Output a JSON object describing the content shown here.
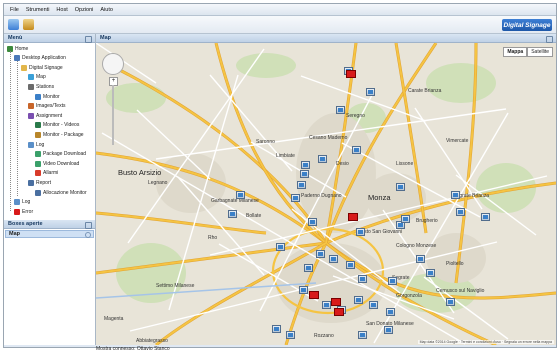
{
  "menubar": [
    "File",
    "Strumenti",
    "Host",
    "Opzioni",
    "Aiuto"
  ],
  "toolbar": {
    "logo": "Digital Signage"
  },
  "sidebar": {
    "title": "Menù",
    "tree": [
      {
        "label": "Home",
        "depth": 0,
        "icon": "home-icon"
      },
      {
        "label": "Desktop Application",
        "depth": 1,
        "icon": "app-icon"
      },
      {
        "label": "Digital Signage",
        "depth": 2,
        "icon": "folder-icon"
      },
      {
        "label": "Map",
        "depth": 3,
        "icon": "map-icon"
      },
      {
        "label": "Stations",
        "depth": 3,
        "icon": "station-icon"
      },
      {
        "label": "Monitor",
        "depth": 4,
        "icon": "monitor-icon"
      },
      {
        "label": "Images/Texts",
        "depth": 3,
        "icon": "image-icon"
      },
      {
        "label": "Assignment",
        "depth": 3,
        "icon": "assign-icon"
      },
      {
        "label": "Monitor - Videos",
        "depth": 4,
        "icon": "video-icon"
      },
      {
        "label": "Monitor - Package",
        "depth": 4,
        "icon": "package-icon"
      },
      {
        "label": "Log",
        "depth": 3,
        "icon": "log-icon"
      },
      {
        "label": "Package Download",
        "depth": 4,
        "icon": "download-icon"
      },
      {
        "label": "Video Download",
        "depth": 4,
        "icon": "download-icon"
      },
      {
        "label": "Allarmi",
        "depth": 4,
        "icon": "alarm-icon"
      },
      {
        "label": "Report",
        "depth": 3,
        "icon": "report-icon"
      },
      {
        "label": "Allocazione Monitor",
        "depth": 4,
        "icon": "report-icon"
      },
      {
        "label": "Log",
        "depth": 1,
        "icon": "log-icon"
      },
      {
        "label": "Error",
        "depth": 1,
        "icon": "error-icon"
      }
    ],
    "open_title": "Boxes aperte",
    "open_items": [
      "Map"
    ]
  },
  "main": {
    "title": "Map",
    "maptypes": [
      "Mappa",
      "Satellite"
    ],
    "copyright": "Map data ©2014 Google  ·  Termini e condizioni d'uso  ·  Segnala un errore nella mappa",
    "towns": [
      {
        "name": "Busto Arsizio",
        "big": true
      },
      {
        "name": "Legnano",
        "big": false
      },
      {
        "name": "Monza",
        "big": true
      },
      {
        "name": "Rho",
        "big": false
      },
      {
        "name": "Saronno",
        "big": false
      },
      {
        "name": "Cesano Maderno",
        "big": false
      },
      {
        "name": "Seregno",
        "big": false
      },
      {
        "name": "Paderno Dugnano",
        "big": false
      },
      {
        "name": "Sesto San Giovanni",
        "big": false
      },
      {
        "name": "Cologno Monzese",
        "big": false
      },
      {
        "name": "Segrate",
        "big": false
      },
      {
        "name": "Pioltello",
        "big": false
      },
      {
        "name": "Rozzano",
        "big": false
      },
      {
        "name": "Magenta",
        "big": false
      },
      {
        "name": "Vimercate",
        "big": false
      },
      {
        "name": "Gorgonzola",
        "big": false
      },
      {
        "name": "Abbiategrasso",
        "big": false
      },
      {
        "name": "Carate Brianza",
        "big": false
      },
      {
        "name": "Desio",
        "big": false
      },
      {
        "name": "Lissone",
        "big": false
      },
      {
        "name": "Cernusco sul Naviglio",
        "big": false
      },
      {
        "name": "Settimo Milanese",
        "big": false
      },
      {
        "name": "Bollate",
        "big": false
      },
      {
        "name": "Limbiate",
        "big": false
      },
      {
        "name": "Brugherio",
        "big": false
      },
      {
        "name": "Agrate Brianza",
        "big": false
      },
      {
        "name": "San Donato Milanese",
        "big": false
      },
      {
        "name": "Garbagnate Milanese",
        "big": false
      }
    ]
  },
  "status": {
    "text": "Mostra connesso: Ottavio Stanco"
  },
  "colors": {
    "accent": "#1d57a8",
    "alert": "#d81a1a",
    "road": "#f5c443"
  }
}
